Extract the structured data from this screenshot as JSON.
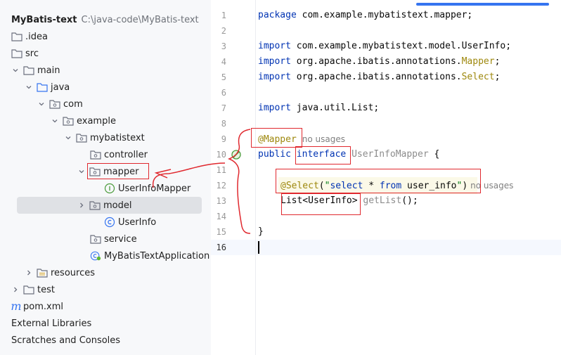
{
  "project": {
    "name": "MyBatis-text",
    "path": "C:\\java-code\\MyBatis-text"
  },
  "tree": {
    "idea": ".idea",
    "src": "src",
    "main": "main",
    "java": "java",
    "com": "com",
    "example": "example",
    "mybatistext": "mybatistext",
    "controller": "controller",
    "mapper": "mapper",
    "userinfomapper": "UserInfoMapper",
    "model": "model",
    "userinfo": "UserInfo",
    "service": "service",
    "app": "MyBatisTextApplication",
    "resources": "resources",
    "test": "test",
    "pom": "pom.xml",
    "external": "External Libraries",
    "scratches": "Scratches and Consoles"
  },
  "editor": {
    "line_numbers": [
      "1",
      "2",
      "3",
      "4",
      "5",
      "6",
      "7",
      "8",
      "9",
      "10",
      "11",
      "12",
      "13",
      "14",
      "15",
      "16"
    ],
    "l1": {
      "kw": "package",
      "rest": " com.example.mybatistext.mapper;"
    },
    "l3": {
      "kw": "import",
      "rest": " com.example.mybatistext.model.UserInfo;"
    },
    "l4": {
      "kw": "import",
      "pre": " org.apache.ibatis.annotations.",
      "ann": "Mapper",
      "end": ";"
    },
    "l5": {
      "kw": "import",
      "pre": " org.apache.ibatis.annotations.",
      "ann": "Select",
      "end": ";"
    },
    "l7": {
      "kw": "import",
      "rest": " java.util.List;"
    },
    "l9": {
      "ann": "@Mapper",
      "hint": "no usages"
    },
    "l10": {
      "kw1": "public",
      "kw2": "interface",
      "name": "UserInfoMapper",
      "brace": " {"
    },
    "l12": {
      "ann": "@Select",
      "open": "(",
      "q1": "\"",
      "s1": "select",
      "star": " * ",
      "s2": "from",
      "s3": " user_info",
      "q2": "\"",
      "close": ")",
      "hint": "no usages"
    },
    "l13": {
      "type": "List<UserInfo>",
      "method": " getList",
      "end": "();"
    },
    "l15": {
      "brace": "}"
    }
  }
}
